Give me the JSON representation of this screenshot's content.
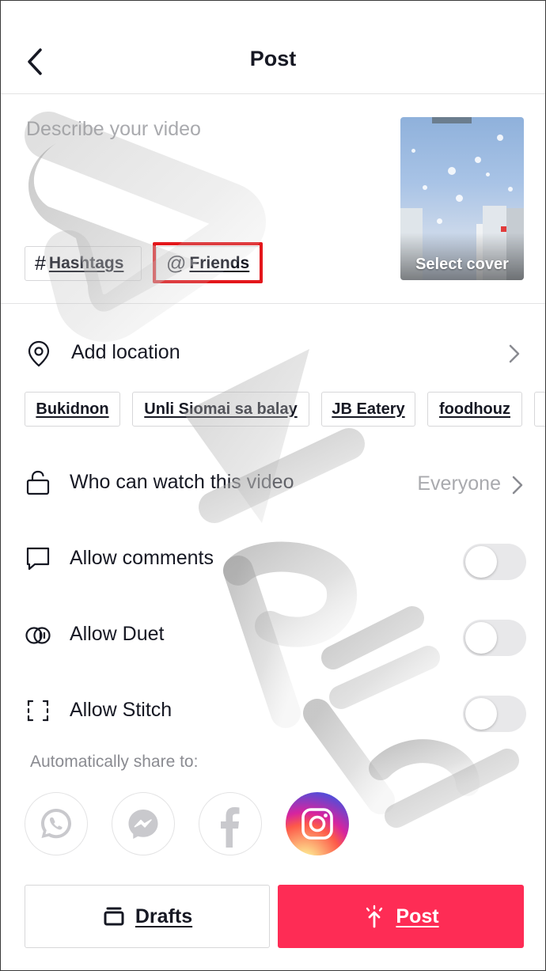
{
  "header": {
    "title": "Post",
    "back_icon": "chevron-left-icon"
  },
  "description": {
    "placeholder": "Describe your video"
  },
  "cover": {
    "label": "Select cover"
  },
  "tags": {
    "hashtags_symbol": "#",
    "hashtags_label": "Hashtags",
    "friends_symbol": "@",
    "friends_label": "Friends"
  },
  "location": {
    "label": "Add location",
    "icon": "location-pin-icon",
    "chips": [
      "Bukidnon",
      "Unli Siomai sa balay",
      "JB Eatery",
      "foodhouz"
    ]
  },
  "settings": {
    "privacy_label": "Who can watch this video",
    "privacy_value": "Everyone",
    "comments_label": "Allow comments",
    "duet_label": "Allow Duet",
    "stitch_label": "Allow Stitch",
    "comments_on": false,
    "duet_on": false,
    "stitch_on": false
  },
  "share": {
    "label": "Automatically share to:",
    "targets": [
      "whatsapp-icon",
      "messenger-icon",
      "facebook-icon",
      "instagram-icon"
    ]
  },
  "actions": {
    "drafts_label": "Drafts",
    "post_label": "Post"
  },
  "colors": {
    "accent": "#fe2c55",
    "highlight": "#e3171b",
    "muted_text": "#a9aaae"
  }
}
